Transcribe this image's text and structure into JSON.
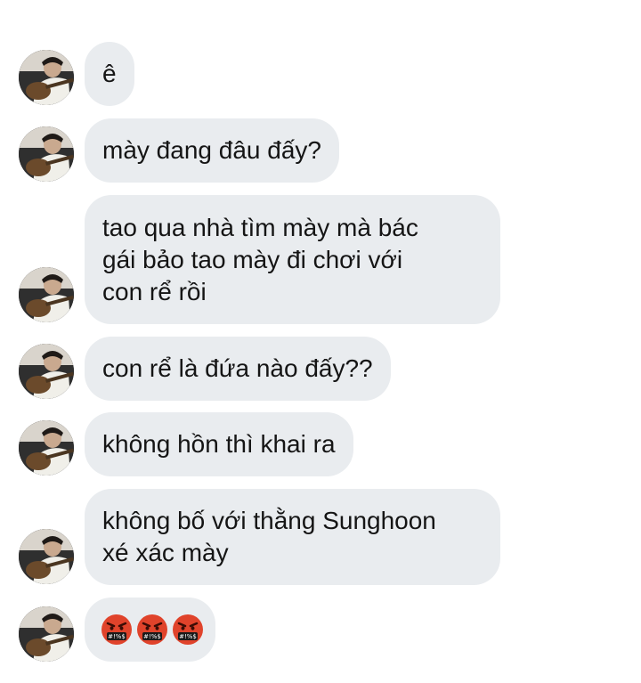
{
  "messages": [
    {
      "text": "ê"
    },
    {
      "text": "mày đang đâu đấy?"
    },
    {
      "lines": [
        "tao qua nhà tìm mày mà bác",
        "gái bảo tao mày đi chơi với",
        "con rể rồi"
      ]
    },
    {
      "text": "con rể là đứa nào đấy??"
    },
    {
      "text": "không hồn thì khai ra"
    },
    {
      "lines": [
        "không bố với thằng Sunghoon",
        "xé xác mày"
      ]
    },
    {
      "emojis": [
        "angry-cursing-face-icon",
        "angry-cursing-face-icon",
        "angry-cursing-face-icon"
      ]
    }
  ],
  "colors": {
    "bubble_background": "#e9ecef",
    "text": "#151515",
    "emoji_red": "#e0432b"
  }
}
